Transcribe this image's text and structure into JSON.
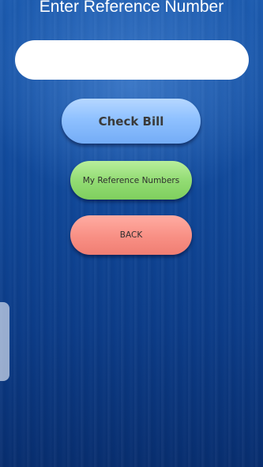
{
  "header": {
    "title": "Enter Reference Number"
  },
  "reference_input": {
    "value": "",
    "placeholder": ""
  },
  "buttons": {
    "check_bill": "Check Bill",
    "my_reference_numbers": "My Reference Numbers",
    "back": "BACK"
  },
  "colors": {
    "background": "#114a9c",
    "check_bill_button": "#8fc1ff",
    "my_reference_numbers_button": "#93dc74",
    "back_button": "#f88f84"
  }
}
